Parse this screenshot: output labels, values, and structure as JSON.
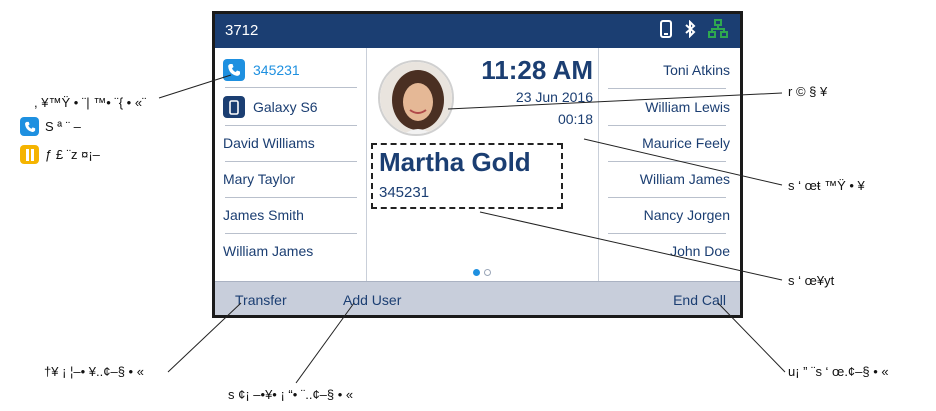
{
  "topbar": {
    "extension": "3712",
    "icons": [
      "mobile-phone-icon",
      "bluetooth-icon",
      "network-icon"
    ]
  },
  "left_column": [
    {
      "label": "345231",
      "icon": "phone-icon",
      "active": true
    },
    {
      "label": "Galaxy S6",
      "icon": "mobile-phone-icon"
    },
    {
      "label": "David Williams"
    },
    {
      "label": "Mary Taylor"
    },
    {
      "label": "James Smith"
    },
    {
      "label": "William James"
    }
  ],
  "right_column": [
    "Toni Atkins",
    "William Lewis",
    "Maurice Feely",
    "William James",
    "Nancy Jorgen",
    "John Doe"
  ],
  "call": {
    "time": "11:28 AM",
    "date": "23 Jun 2016",
    "duration": "00:18",
    "caller_name": "Martha Gold",
    "caller_number": "345231",
    "page_indicator": {
      "current": 1,
      "total": 2
    }
  },
  "softkeys": {
    "transfer": "Transfer",
    "add_user": "Add User",
    "end_call": "End Call"
  },
  "callouts": {
    "left_top": ", ¥™Ÿ • ¨| ™• ¨{ • «¨",
    "left_leg1": "S ª ¨ –",
    "left_leg2": "ƒ £ ¨z ¤¡–",
    "right_photo": "r © § ¥",
    "right_duration": "s ‘ œŧ ™Ÿ • ¥",
    "right_caller": "s ‘ œ¥yt",
    "bottom_left": "†¥ ¡ ¦–• ¥..¢–§ • «",
    "bottom_middle": "s ¢¡ –•¥• ¡ “• ¨..¢–§ • «",
    "bottom_right": "u¡ ” ¨s ‘ œ.¢–§ • «"
  },
  "colors": {
    "brand": "#1b3e72",
    "active_call": "#1e90e0",
    "hold": "#f5b400",
    "network": "#2fa84f"
  }
}
